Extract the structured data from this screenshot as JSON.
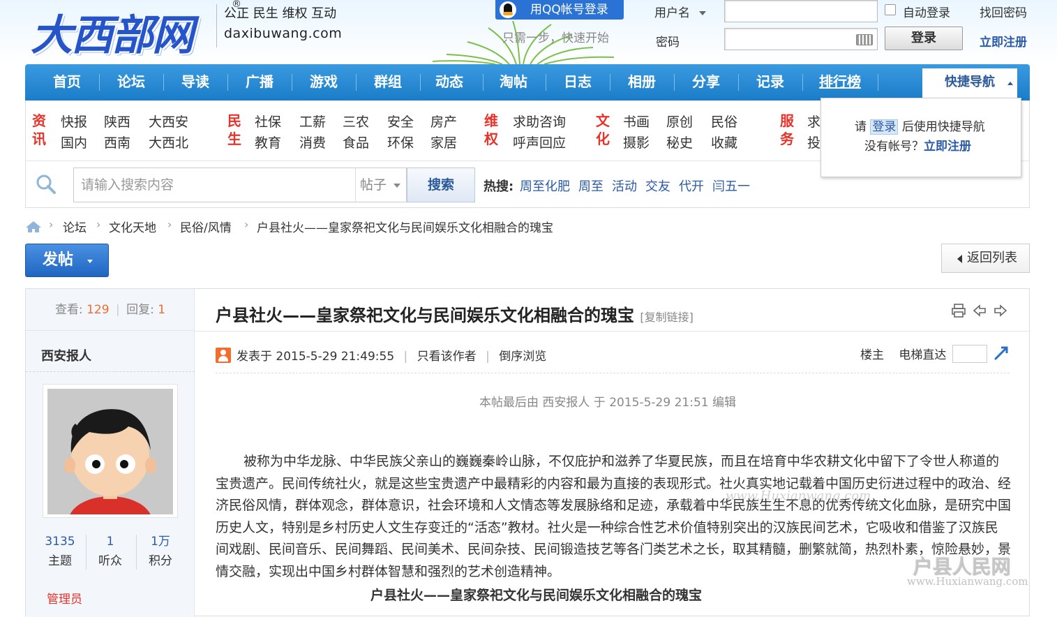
{
  "header": {
    "logo_text": "大西部网",
    "reg_mark": "®",
    "slogan_line1": "公正 民生 维权 互动",
    "slogan_line2": "daxibuwang.com",
    "qq_login_label": "用QQ帐号登录",
    "qq_hint": "只需一步，快速开始",
    "username_label": "用户名",
    "password_label": "密码",
    "auto_login_label": "自动登录",
    "find_password": "找回密码",
    "login_button": "登录",
    "register_link": "立即注册"
  },
  "nav": {
    "items": [
      "首页",
      "论坛",
      "导读",
      "广播",
      "游戏",
      "群组",
      "动态",
      "淘帖",
      "日志",
      "相册",
      "分享",
      "记录",
      "排行榜"
    ],
    "quick_nav": "快捷导航"
  },
  "submenu": {
    "cat_news": [
      "资",
      "讯"
    ],
    "news_links": [
      "快报",
      "陕西",
      "大西安",
      "国内",
      "西南",
      "大西北"
    ],
    "cat_life": [
      "民",
      "生"
    ],
    "life_links": [
      "社保",
      "工薪",
      "三农",
      "安全",
      "房产",
      "教育",
      "消费",
      "食品",
      "环保",
      "家居"
    ],
    "cat_rights": [
      "维",
      "权"
    ],
    "rights_links": [
      "求助咨询",
      "呼声回应"
    ],
    "cat_culture": [
      "文",
      "化"
    ],
    "culture_links": [
      "书画",
      "原创",
      "民俗",
      "摄影",
      "秘史",
      "收藏"
    ],
    "cat_service": [
      "服",
      "务"
    ],
    "service_links": [
      "求",
      "投"
    ]
  },
  "quick_nav_panel": {
    "prefix": "请",
    "login_word": "登录",
    "suffix": "后使用快捷导航",
    "no_account": "没有帐号？",
    "register": "立即注册"
  },
  "search": {
    "placeholder": "请输入搜索内容",
    "type": "帖子",
    "button": "搜索",
    "hot_label": "热搜:",
    "hot_links": [
      "周至化肥",
      "周至",
      "活动",
      "交友",
      "代开",
      "闫五一"
    ]
  },
  "breadcrumb": [
    "论坛",
    "文化天地",
    "民俗/风情",
    "户县社火——皇家祭祀文化与民间娱乐文化相融合的瑰宝"
  ],
  "actions": {
    "post_button": "发帖",
    "back_button": "返回列表"
  },
  "thread": {
    "views_label": "查看:",
    "views": "129",
    "replies_label": "回复:",
    "replies": "1",
    "stat_sep": "|",
    "title": "户县社火——皇家祭祀文化与民间娱乐文化相融合的瑰宝",
    "copy_link": "[复制链接]",
    "author": "西安报人",
    "author_stats": [
      {
        "value": "3135",
        "label": "主题"
      },
      {
        "value": "1",
        "label": "听众"
      },
      {
        "value": "1万",
        "label": "积分"
      }
    ],
    "author_role": "管理员",
    "posted_at": "发表于 2015-5-29 21:49:55",
    "only_author": "只看该作者",
    "reverse": "倒序浏览",
    "floor_label": "楼主",
    "jump_label": "电梯直达",
    "edit_note": "本帖最后由 西安报人 于 2015-5-29 21:51 编辑",
    "body": "被称为中华龙脉、中华民族父亲山的巍巍秦岭山脉，不仅庇护和滋养了华夏民族，而且在培育中华农耕文化中留下了令世人称道的宝贵遗产。民间传统社火，就是这些宝贵遗产中最精彩的内容和最为直接的表现形式。社火真实地记载着中国历史衍进过程中的政治、经济民俗风情，群体观念，群体意识，社会环境和人文情态等发展脉络和足迹，承载着中华民族生生不息的优秀传统文化血脉，是研究中国历史人文，特别是乡村历史人文生存变迁的“活态”教材。社火是一种综合性艺术价值特别突出的汉族民间艺术，它吸收和借鉴了汉族民间戏剧、民间音乐、民间舞蹈、民间美术、民间杂技、民间锻造技艺等各门类艺术之长，取其精髓，删繁就简，热烈朴素，惊险悬妙，景情交融，实现出中国乡村群体智慧和强烈的艺术创造精神。",
    "subtitle": "户县社火——皇家祭祀文化与民间娱乐文化相融合的瑰宝"
  },
  "watermarks": {
    "wm1": "www.Huxianwang.com",
    "wm2": "户县人民网",
    "wm3": "www.Huxianwang.com"
  }
}
